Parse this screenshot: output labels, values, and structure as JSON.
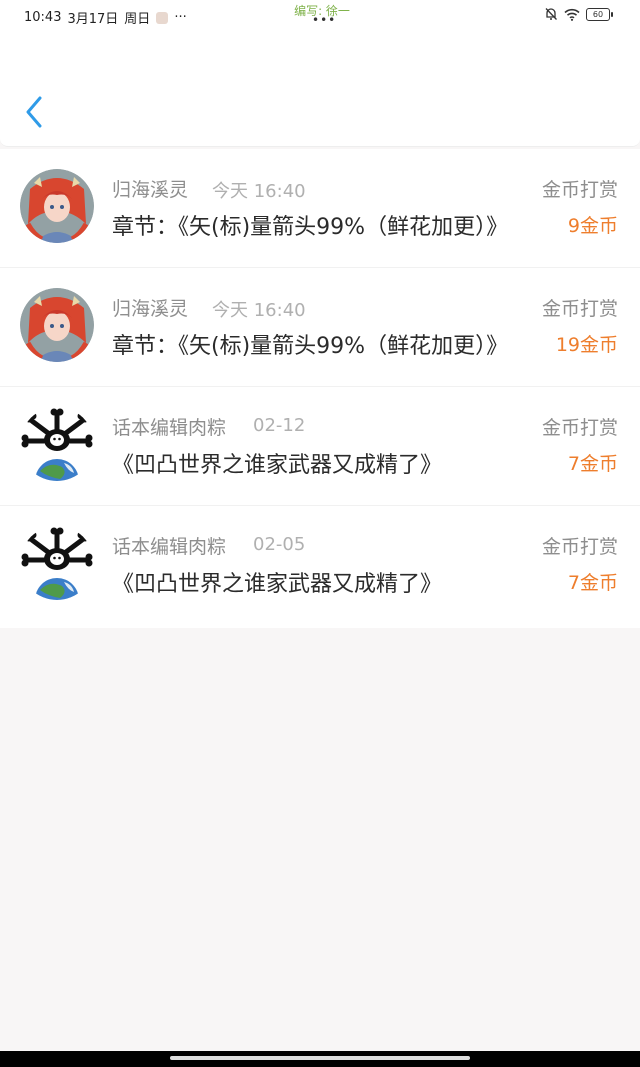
{
  "status_bar": {
    "time": "10:43",
    "date": "3月17日",
    "weekday": "周日",
    "more": "···",
    "center_label": "编写: 徐一",
    "center_dots": "•••",
    "battery": "60"
  },
  "colors": {
    "accent_blue": "#2f9be8",
    "amount_orange": "#ee7e2d"
  },
  "items": [
    {
      "name": "归海溪灵",
      "time": "今天 16:40",
      "type": "金币打赏",
      "content": "章节：《矢(标)量箭头99%（鲜花加更）》",
      "amount": "9金币",
      "avatar_icon": "anime-girl-avatar"
    },
    {
      "name": "归海溪灵",
      "time": "今天 16:40",
      "type": "金币打赏",
      "content": "章节：《矢(标)量箭头99%（鲜花加更）》",
      "amount": "19金币",
      "avatar_icon": "anime-girl-avatar"
    },
    {
      "name": "话本编辑肉粽",
      "time": "02-12",
      "type": "金币打赏",
      "content": "《凹凸世界之谁家武器又成精了》",
      "amount": "7金币",
      "avatar_icon": "bone-earth-avatar"
    },
    {
      "name": "话本编辑肉粽",
      "time": "02-05",
      "type": "金币打赏",
      "content": "《凹凸世界之谁家武器又成精了》",
      "amount": "7金币",
      "avatar_icon": "bone-earth-avatar"
    }
  ]
}
